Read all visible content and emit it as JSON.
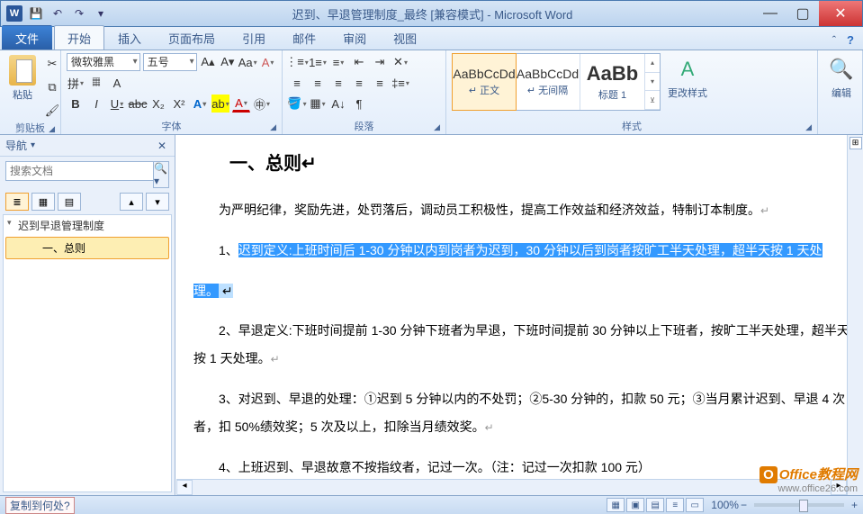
{
  "title": "迟到、早退管理制度_最终 [兼容模式] - Microsoft Word",
  "qat": {
    "save": "💾",
    "undo": "↶",
    "redo": "↷",
    "more": "▾"
  },
  "tabs": {
    "file": "文件",
    "home": "开始",
    "insert": "插入",
    "layout": "页面布局",
    "ref": "引用",
    "mail": "邮件",
    "review": "审阅",
    "view": "视图"
  },
  "ribbon": {
    "clipboard": {
      "paste": "粘贴",
      "title": "剪贴板"
    },
    "font": {
      "family": "微软雅黑",
      "size": "五号",
      "title": "字体"
    },
    "para": {
      "title": "段落"
    },
    "styles": {
      "title": "样式",
      "items": [
        {
          "prev": "AaBbCcDd",
          "name": "↵ 正文"
        },
        {
          "prev": "AaBbCcDd",
          "name": "↵ 无间隔"
        },
        {
          "prev": "AaBb",
          "name": "标题 1"
        }
      ],
      "change": "更改样式"
    },
    "editing": {
      "title": "编辑"
    }
  },
  "nav": {
    "title": "导航",
    "search_ph": "搜索文档",
    "tree_root": "迟到早退管理制度",
    "tree_child": "一、总则"
  },
  "doc": {
    "heading": "一、总则↵",
    "p1": "为严明纪律，奖励先进，处罚落后，调动员工积极性，提高工作效益和经济效益，特制订本制度。",
    "p2a": "1、",
    "p2sel": "迟到定义:上班时间后 1-30 分钟以内到岗者为迟到，30 分钟以后到岗者按旷工半天处理，超半天按 1 天处",
    "p2b": "理。",
    "p3": "2、早退定义:下班时间提前 1-30 分钟下班者为早退，下班时间提前 30 分钟以上下班者，按旷工半天处理，超半天按 1 天处理。",
    "p4": "3、对迟到、早退的处理：①迟到 5 分钟以内的不处罚；②5-30 分钟的，扣款 50 元；③当月累计迟到、早退 4 次者，扣 50%绩效奖；5 次及以上，扣除当月绩效奖。",
    "p5": "4、上班迟到、早退故意不按指纹者，记过一次。（注：记过一次扣款 100 元）"
  },
  "status": {
    "msg": "复制到何处?",
    "zoom": "100%"
  },
  "watermark": {
    "brand": "Office教程网",
    "url": "www.office26.com"
  }
}
